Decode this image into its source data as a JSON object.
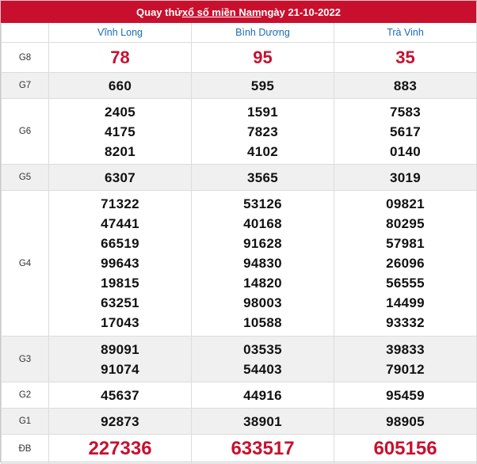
{
  "title": {
    "prefix": "Quay thử ",
    "link": "xổ số miền Nam",
    "suffix": " ngày 21-10-2022"
  },
  "provinces": [
    "Vĩnh Long",
    "Bình Dương",
    "Trà Vinh"
  ],
  "rows": [
    {
      "label": "G8",
      "values": [
        [
          "78"
        ],
        [
          "95"
        ],
        [
          "35"
        ]
      ]
    },
    {
      "label": "G7",
      "values": [
        [
          "660"
        ],
        [
          "595"
        ],
        [
          "883"
        ]
      ]
    },
    {
      "label": "G6",
      "values": [
        [
          "2405",
          "4175",
          "8201"
        ],
        [
          "1591",
          "7823",
          "4102"
        ],
        [
          "7583",
          "5617",
          "0140"
        ]
      ]
    },
    {
      "label": "G5",
      "values": [
        [
          "6307"
        ],
        [
          "3565"
        ],
        [
          "3019"
        ]
      ]
    },
    {
      "label": "G4",
      "values": [
        [
          "71322",
          "47441",
          "66519",
          "99643",
          "19815",
          "63251",
          "17043"
        ],
        [
          "53126",
          "40168",
          "91628",
          "94830",
          "14820",
          "98003",
          "10588"
        ],
        [
          "09821",
          "80295",
          "57981",
          "26096",
          "56555",
          "14499",
          "93332"
        ]
      ]
    },
    {
      "label": "G3",
      "values": [
        [
          "89091",
          "91074"
        ],
        [
          "03535",
          "54403"
        ],
        [
          "39833",
          "79012"
        ]
      ]
    },
    {
      "label": "G2",
      "values": [
        [
          "45637"
        ],
        [
          "44916"
        ],
        [
          "95459"
        ]
      ]
    },
    {
      "label": "G1",
      "values": [
        [
          "92873"
        ],
        [
          "38901"
        ],
        [
          "98905"
        ]
      ]
    },
    {
      "label": "ĐB",
      "values": [
        [
          "227336"
        ],
        [
          "633517"
        ],
        [
          "605156"
        ]
      ]
    }
  ]
}
